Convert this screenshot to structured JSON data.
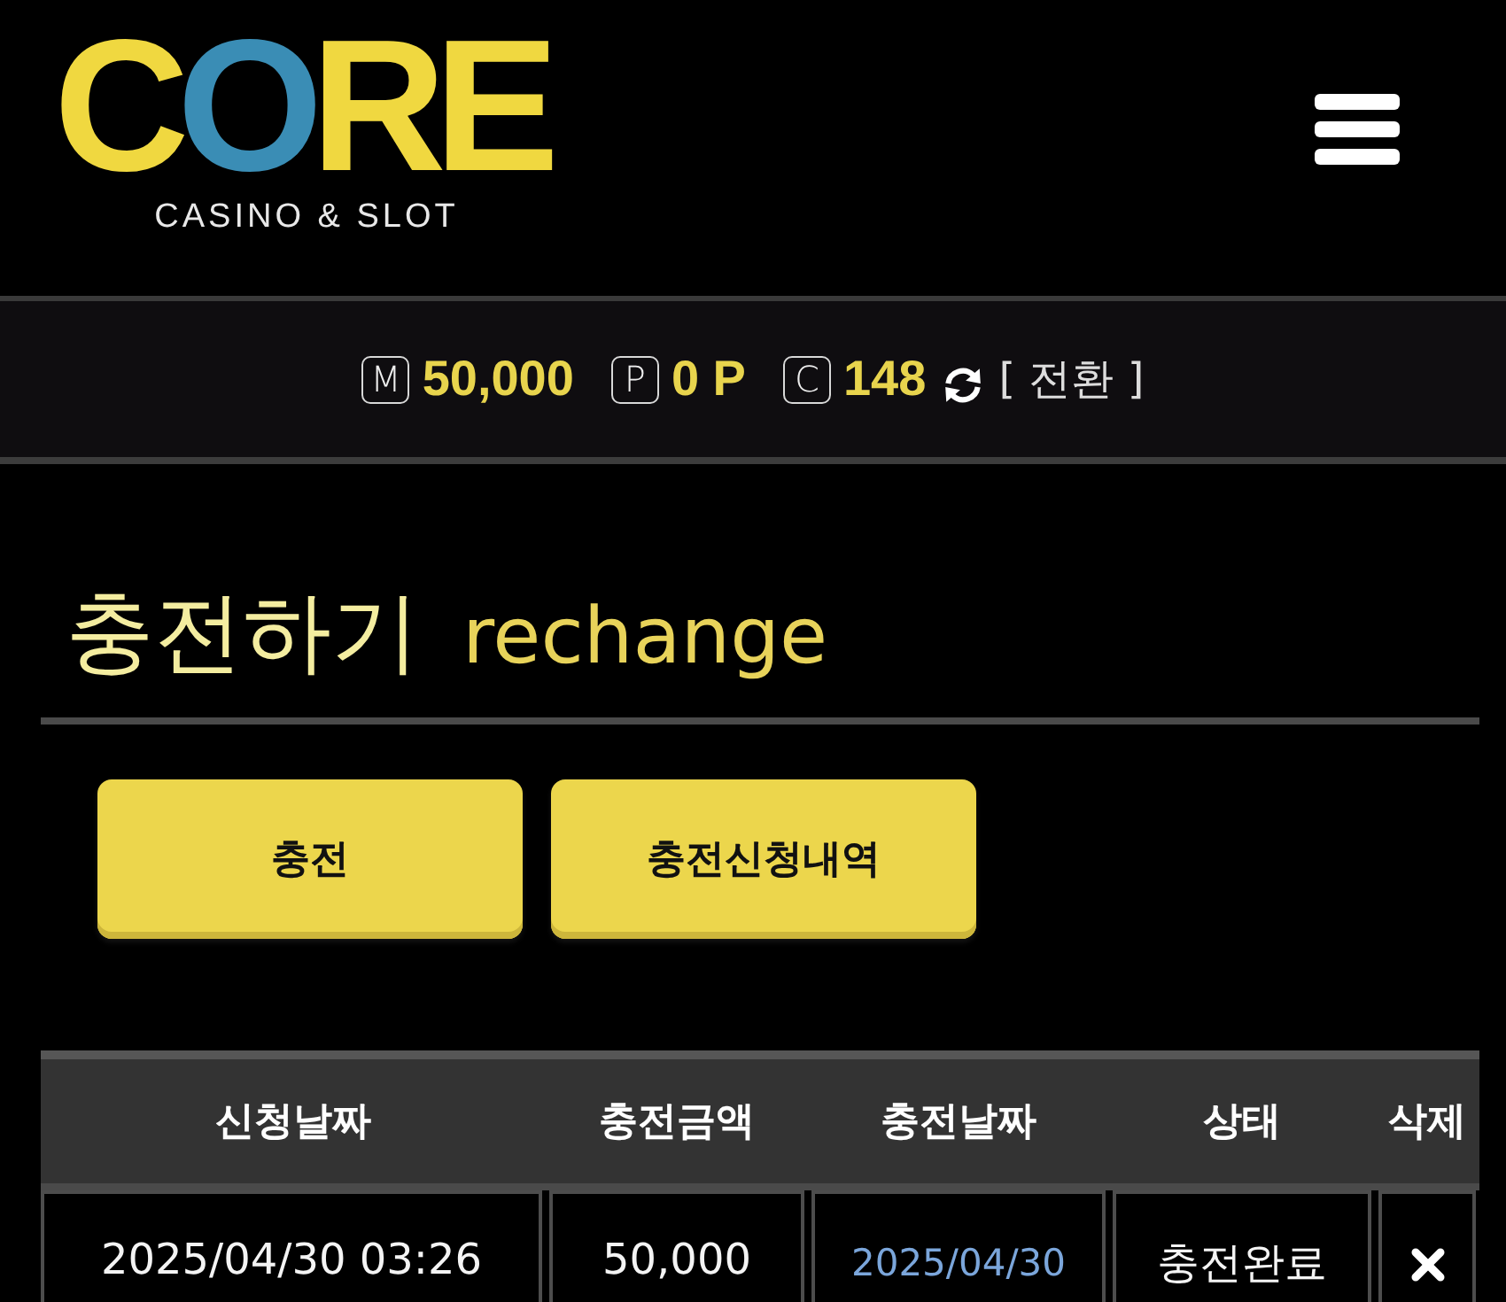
{
  "header": {
    "logo": {
      "wordmark": "CORE",
      "tagline": "CASINO & SLOT"
    }
  },
  "balance_bar": {
    "items": [
      {
        "badge": "M",
        "value": "50,000"
      },
      {
        "badge": "P",
        "value": "0 P"
      },
      {
        "badge": "C",
        "value": "148"
      }
    ],
    "convert_link": "[ 전환 ]"
  },
  "page": {
    "title": "충전하기",
    "subtitle": "rechange"
  },
  "buttons": [
    {
      "label": "충전"
    },
    {
      "label": "충전신청내역"
    }
  ],
  "table": {
    "columns": [
      "신청날짜",
      "충전금액",
      "충전날짜",
      "상태",
      "삭제"
    ],
    "rows": [
      {
        "requested_at": "2025/04/30 03:26",
        "amount": "50,000",
        "charged_at": "2025/04/30",
        "status": "충전완료"
      }
    ]
  }
}
